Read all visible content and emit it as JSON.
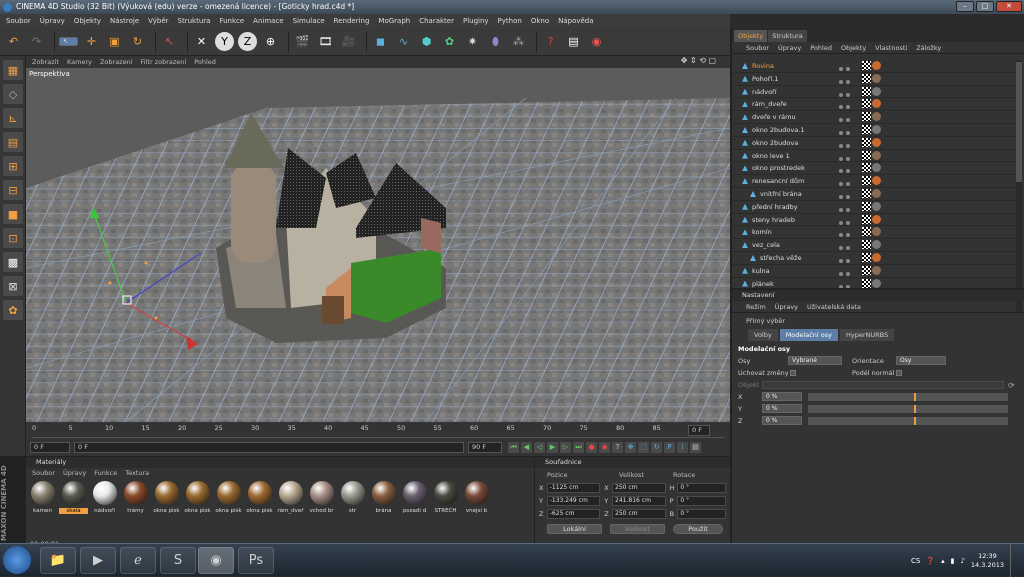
{
  "title": "CINEMA 4D Studio (32 Bit) (Výuková (edu) verze - omezená licence) - [Goticky hrad.c4d *]",
  "menu": [
    "Soubor",
    "Úpravy",
    "Objekty",
    "Nástroje",
    "Výběr",
    "Struktura",
    "Funkce",
    "Animace",
    "Simulace",
    "Rendering",
    "MoGraph",
    "Charakter",
    "Pluginy",
    "Python",
    "Okno",
    "Nápověda"
  ],
  "viewport": {
    "menu": [
      "Zobrazit",
      "Kamery",
      "Zobrazení",
      "Filtr zobrazení",
      "Pohled"
    ],
    "label": "Perspektiva"
  },
  "timeline": {
    "ticks": [
      "0",
      "5",
      "10",
      "15",
      "20",
      "25",
      "30",
      "35",
      "40",
      "45",
      "50",
      "55",
      "60",
      "65",
      "70",
      "75",
      "80",
      "85",
      "90"
    ],
    "frame_left": "0 F",
    "frame_mid": "0 F",
    "frame_end": "90 F",
    "frame_end2": "90 F",
    "cur": "0 F"
  },
  "objects": {
    "tabs": [
      "Objekty",
      "Struktura"
    ],
    "menu": [
      "Soubor",
      "Úpravy",
      "Pohled",
      "Objekty",
      "Vlastnosti",
      "Záložky"
    ],
    "rows": [
      {
        "name": "Rovina",
        "indent": 0,
        "color": "#f0a040"
      },
      {
        "name": "Pohoří.1",
        "indent": 0,
        "color": "#ddd"
      },
      {
        "name": "nádvoří",
        "indent": 0,
        "color": "#ddd"
      },
      {
        "name": "rám_dveře",
        "indent": 0,
        "color": "#ddd"
      },
      {
        "name": "dveře v rámu",
        "indent": 0,
        "color": "#ddd"
      },
      {
        "name": "okno 2budova.1",
        "indent": 0,
        "color": "#ddd"
      },
      {
        "name": "okno 2budova",
        "indent": 0,
        "color": "#ddd"
      },
      {
        "name": "okno leve 1",
        "indent": 0,
        "color": "#ddd"
      },
      {
        "name": "okno prostredek",
        "indent": 0,
        "color": "#ddd"
      },
      {
        "name": "renesancní dům",
        "indent": 0,
        "color": "#ddd"
      },
      {
        "name": "vnitřní brána",
        "indent": 1,
        "color": "#ddd"
      },
      {
        "name": "přední hradby",
        "indent": 0,
        "color": "#ddd"
      },
      {
        "name": "steny hradeb",
        "indent": 0,
        "color": "#ddd"
      },
      {
        "name": "komín",
        "indent": 0,
        "color": "#ddd"
      },
      {
        "name": "vez_cela",
        "indent": 0,
        "color": "#ddd"
      },
      {
        "name": "střecha věže",
        "indent": 1,
        "color": "#ddd"
      },
      {
        "name": "kulna",
        "indent": 0,
        "color": "#ddd"
      },
      {
        "name": "plánek",
        "indent": 0,
        "color": "#ddd"
      }
    ]
  },
  "attributes": {
    "header": "Nastavení",
    "menu": [
      "Režim",
      "Úpravy",
      "Uživatelská data"
    ],
    "tool": "Přímý výběr",
    "tabs": [
      "Volby",
      "Modelační osy",
      "HyperNURBS"
    ],
    "section": "Modelační osy",
    "osy_label": "Osy",
    "osy_value": "Vybrané",
    "orient_label": "Orientace",
    "orient_value": "Osy",
    "uchovat": "Uchovat změny",
    "podel": "Podél normál",
    "objekt": "Objekt",
    "axes": [
      {
        "ax": "X",
        "v": "0 %"
      },
      {
        "ax": "Y",
        "v": "0 %"
      },
      {
        "ax": "Z",
        "v": "0 %"
      }
    ]
  },
  "materials": {
    "header": "Materiály",
    "menu": [
      "Soubor",
      "Úpravy",
      "Funkce",
      "Textura"
    ],
    "items": [
      {
        "name": "kamen",
        "color": "#8a8270"
      },
      {
        "name": "skala",
        "color": "#5a5a50"
      },
      {
        "name": "nádvoří",
        "color": "#e8e8e8"
      },
      {
        "name": "trámy",
        "color": "#8a4a2a"
      },
      {
        "name": "okna pisk",
        "color": "#9a6a30"
      },
      {
        "name": "okna pisk",
        "color": "#9a6a30"
      },
      {
        "name": "okna pisk",
        "color": "#9a6a30"
      },
      {
        "name": "okna pisk",
        "color": "#a06a30"
      },
      {
        "name": "rám_dveř",
        "color": "#b8a890"
      },
      {
        "name": "vchod br",
        "color": "#a89088"
      },
      {
        "name": "str",
        "color": "#9a9a90"
      },
      {
        "name": "brána",
        "color": "#8a6040"
      },
      {
        "name": "pozadí d",
        "color": "#6a6070"
      },
      {
        "name": "STRECH",
        "color": "#4a4a40"
      },
      {
        "name": "vnejsi b",
        "color": "#7a4a3a"
      }
    ],
    "status": "00:00:01"
  },
  "coords": {
    "header": "Souřadnice",
    "col1": "Pozice",
    "col2": "Velikost",
    "col3": "Rotace",
    "rows": [
      {
        "a": "X",
        "p": "-1125 cm",
        "b": "X",
        "s": "250 cm",
        "c": "H",
        "r": "0 °"
      },
      {
        "a": "Y",
        "p": "-133.249 cm",
        "b": "Y",
        "s": "241.816 cm",
        "c": "P",
        "r": "0 °"
      },
      {
        "a": "Z",
        "p": "-625 cm",
        "b": "Z",
        "s": "250 cm",
        "c": "B",
        "r": "0 °"
      }
    ],
    "mode1": "Lokální",
    "mode2": "Velikost",
    "apply": "Použít"
  },
  "taskbar": {
    "lang": "CS",
    "time": "12:39",
    "date": "14.3.2013"
  }
}
